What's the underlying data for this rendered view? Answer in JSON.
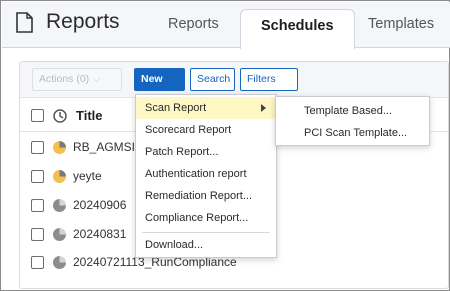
{
  "header": {
    "title": "Reports",
    "tabs": [
      {
        "label": "Reports",
        "active": false
      },
      {
        "label": "Schedules",
        "active": true
      },
      {
        "label": "Templates",
        "active": false
      }
    ]
  },
  "toolbar": {
    "actions_label": "Actions (0)",
    "new_label": "New",
    "search_label": "Search",
    "filters_label": "Filters"
  },
  "table": {
    "column_title": "Title",
    "rows": [
      {
        "title": "RB_AGMSI",
        "status": "in-progress",
        "status_color": "#f3c14b"
      },
      {
        "title": "yeyte",
        "status": "in-progress",
        "status_color": "#f3c14b"
      },
      {
        "title": "20240906",
        "status": "scheduled",
        "status_color": "#8c8c8c"
      },
      {
        "title": "20240831",
        "status": "scheduled",
        "status_color": "#8c8c8c"
      },
      {
        "title": "20240721113_RunCompliance",
        "status": "scheduled",
        "status_color": "#8c8c8c"
      }
    ]
  },
  "new_menu": {
    "items": [
      {
        "label": "Scan Report",
        "has_submenu": true,
        "highlighted": true
      },
      {
        "label": "Scorecard Report"
      },
      {
        "label": "Patch Report..."
      },
      {
        "label": "Authentication report"
      },
      {
        "label": "Remediation Report..."
      },
      {
        "label": "Compliance Report..."
      },
      {
        "label": "Download..."
      }
    ],
    "submenu": [
      {
        "label": "Template Based..."
      },
      {
        "label": "PCI Scan Template..."
      }
    ]
  },
  "colors": {
    "primary": "#1565c0",
    "highlight": "#fdf7c4",
    "header_bg": "#f4f6f9"
  },
  "icons": [
    "document-icon",
    "clock-status-icon",
    "chevron-down-icon",
    "submenu-arrow-icon"
  ]
}
